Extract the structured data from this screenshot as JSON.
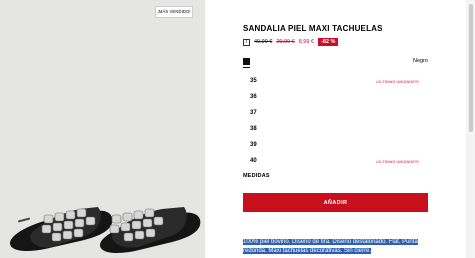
{
  "image": {
    "badge": "¡MÁS VENDIDO!"
  },
  "product": {
    "title": "SANDALIA PIEL MAXI TACHUELAS",
    "prices": {
      "original": "49,99 €",
      "previous": "29,99 €",
      "current": "8,99 €",
      "discount": "-82 %"
    },
    "color": {
      "name": "Negro",
      "swatch": "#111111"
    }
  },
  "sizes": [
    {
      "size": "35",
      "note": "¡ÚLTIMAS UNIDADES!"
    },
    {
      "size": "36",
      "note": ""
    },
    {
      "size": "37",
      "note": ""
    },
    {
      "size": "38",
      "note": ""
    },
    {
      "size": "39",
      "note": ""
    },
    {
      "size": "40",
      "note": "¡ÚLTIMAS UNIDADES!"
    }
  ],
  "measures_label": "MEDIDAS",
  "add_button": "AÑADIR",
  "description": {
    "line1": "100% piel bovino. Diseño de tira. Diseño destalonado. Flat. Punta",
    "line2": "redonda. Maxi tachuelas decorativas. Sin cierre."
  },
  "colors": {
    "accent": "#c8102e",
    "selection": "#2f5fb3"
  }
}
